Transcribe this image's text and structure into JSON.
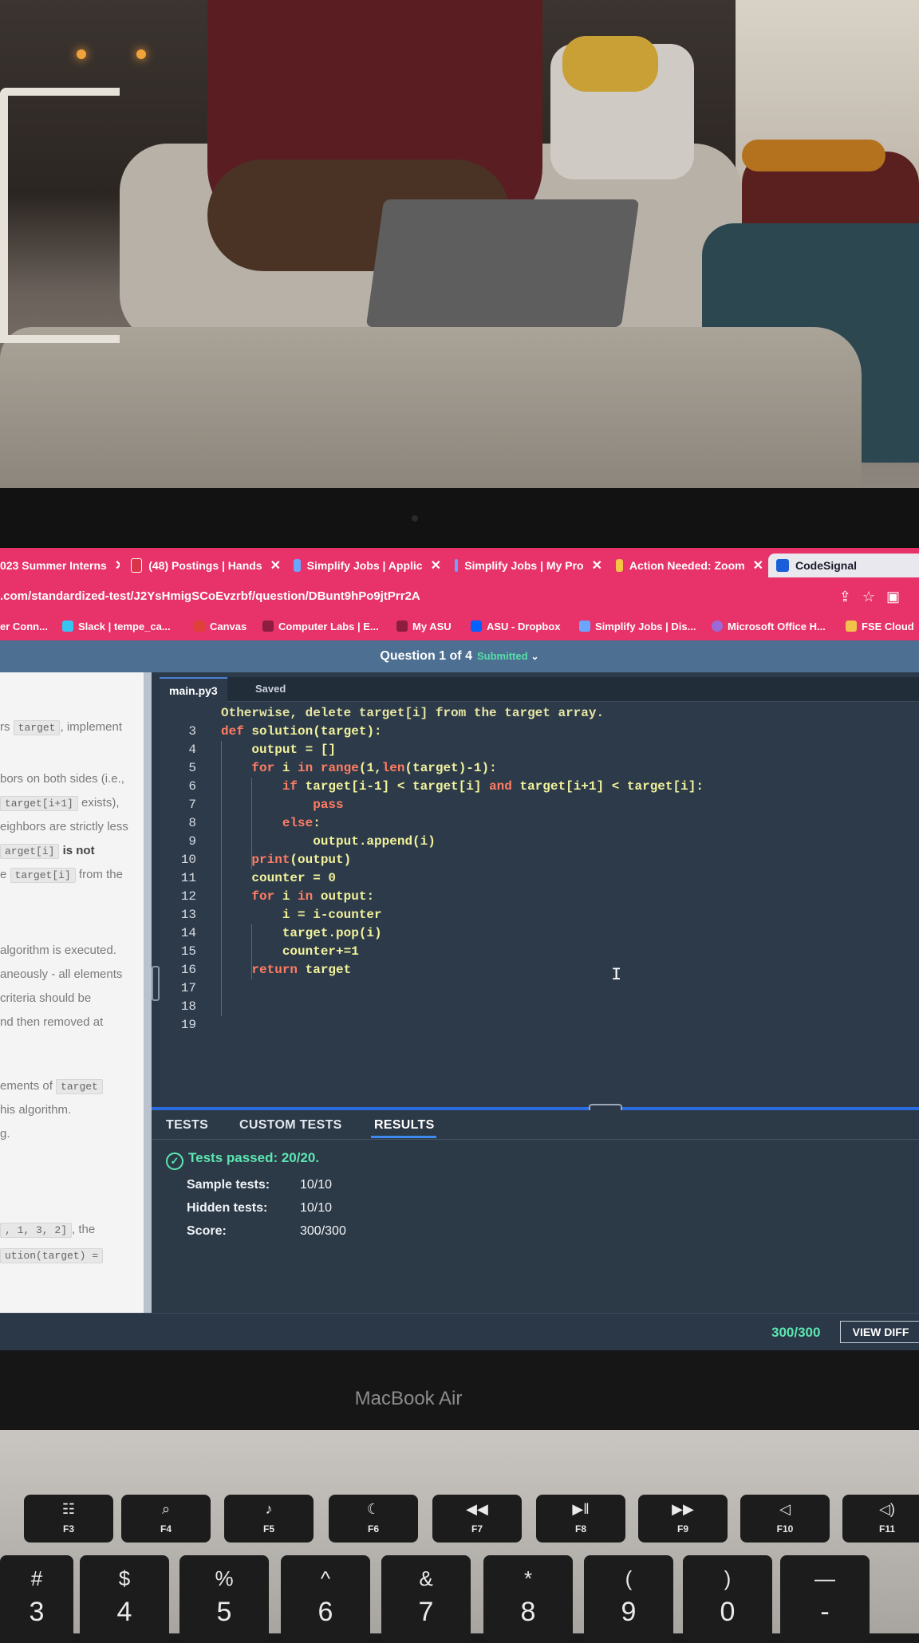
{
  "browser": {
    "tabs": [
      {
        "label": "023 Summer Interns",
        "active": false
      },
      {
        "label": "(48) Postings | Hands",
        "active": false
      },
      {
        "label": "Simplify Jobs | Applic",
        "active": false
      },
      {
        "label": "Simplify Jobs | My Pro",
        "active": false
      },
      {
        "label": "Action Needed: Zoom",
        "active": false
      },
      {
        "label": "CodeSignal",
        "active": true
      }
    ],
    "url": ".com/standardized-test/J2YsHmigSCoEvzrbf/question/DBunt9hPo9jtPrr2A",
    "bookmarks": [
      "er Conn...",
      "Slack | tempe_ca...",
      "Canvas",
      "Computer Labs | E...",
      "My ASU",
      "ASU - Dropbox",
      "Simplify Jobs | Dis...",
      "Microsoft Office H...",
      "FSE Cloud"
    ]
  },
  "header": {
    "question": "Question 1 of 4",
    "status": "Submitted",
    "chevron": "chevron-down-icon"
  },
  "left_panel": {
    "lines": [
      {
        "pre": "rs ",
        "code": "target",
        "post": ", implement"
      },
      {
        "pre": "",
        "code": "",
        "post": ""
      },
      {
        "pre": "bors on both sides (i.e.,",
        "code": "",
        "post": ""
      },
      {
        "pre": "",
        "code": "target[i+1]",
        "post": " exists),"
      },
      {
        "pre": "eighbors are strictly less",
        "code": "",
        "post": ""
      },
      {
        "pre": "",
        "code": "arget[i]",
        "post": " is not",
        "bold_post": true
      },
      {
        "pre": "e ",
        "code": "target[i]",
        "post": " from the"
      },
      {
        "pre": " algorithm is executed.",
        "code": "",
        "post": ""
      },
      {
        "pre": "aneously - all elements",
        "code": "",
        "post": ""
      },
      {
        "pre": " criteria should be",
        "code": "",
        "post": ""
      },
      {
        "pre": "nd then removed at",
        "code": "",
        "post": ""
      },
      {
        "pre": "ements of ",
        "code": "target",
        "post": ""
      },
      {
        "pre": "his algorithm.",
        "code": "",
        "post": ""
      },
      {
        "pre": "g.",
        "code": "",
        "post": ""
      },
      {
        "pre": "",
        "code": ", 1, 3, 2]",
        "post": ", the"
      },
      {
        "pre": "",
        "code": "ution(target) =",
        "post": ""
      }
    ]
  },
  "editor": {
    "file_tab": "main.py3",
    "save_status": "Saved",
    "lines": [
      {
        "n": "",
        "text": "Otherwise, delete target[i] from the target array."
      },
      {
        "n": "3",
        "text": "def solution(target):"
      },
      {
        "n": "4",
        "text": "    output = []"
      },
      {
        "n": "5",
        "text": "    for i in range(1,len(target)-1):"
      },
      {
        "n": "6",
        "text": "        if target[i-1] < target[i] and target[i+1] < target[i]:"
      },
      {
        "n": "7",
        "text": "            pass"
      },
      {
        "n": "8",
        "text": "        else:"
      },
      {
        "n": "9",
        "text": "            output.append(i)"
      },
      {
        "n": "10",
        "text": "    print(output)"
      },
      {
        "n": "11",
        "text": "    counter = 0"
      },
      {
        "n": "12",
        "text": "    for i in output:"
      },
      {
        "n": "13",
        "text": "        i = i-counter"
      },
      {
        "n": "14",
        "text": "        target.pop(i)"
      },
      {
        "n": "15",
        "text": "        counter+=1"
      },
      {
        "n": "16",
        "text": "    return target"
      },
      {
        "n": "17",
        "text": ""
      },
      {
        "n": "18",
        "text": ""
      },
      {
        "n": "19",
        "text": ""
      }
    ]
  },
  "results": {
    "tabs": [
      "TESTS",
      "CUSTOM TESTS",
      "RESULTS"
    ],
    "active_tab": "RESULTS",
    "summary": "Tests passed: 20/20.",
    "stats": [
      {
        "label": "Sample tests:",
        "value": "10/10"
      },
      {
        "label": "Hidden tests:",
        "value": "10/10"
      },
      {
        "label": "Score:",
        "value": "300/300"
      }
    ]
  },
  "footer": {
    "score": "300/300",
    "view_diff": "VIEW DIFF"
  },
  "laptop": {
    "brand": "MacBook Air",
    "fkeys": [
      {
        "icon": "☷",
        "label": "F3"
      },
      {
        "icon": "⌕",
        "label": "F4"
      },
      {
        "icon": "♪",
        "label": "F5"
      },
      {
        "icon": "☾",
        "label": "F6"
      },
      {
        "icon": "◀◀",
        "label": "F7"
      },
      {
        "icon": "▶‖",
        "label": "F8"
      },
      {
        "icon": "▶▶",
        "label": "F9"
      },
      {
        "icon": "◁",
        "label": "F10"
      },
      {
        "icon": "◁)",
        "label": "F11"
      }
    ],
    "numkeys": [
      {
        "top": "#",
        "bottom": "3"
      },
      {
        "top": "$",
        "bottom": "4"
      },
      {
        "top": "%",
        "bottom": "5"
      },
      {
        "top": "^",
        "bottom": "6"
      },
      {
        "top": "&",
        "bottom": "7"
      },
      {
        "top": "*",
        "bottom": "8"
      },
      {
        "top": "(",
        "bottom": "9"
      },
      {
        "top": ")",
        "bottom": "0"
      },
      {
        "top": "—",
        "bottom": "-"
      }
    ]
  },
  "colors": {
    "chrome_pink": "#e8326a",
    "header_blue": "#4d6f91",
    "editor_bg": "#2d3a4a",
    "code_yellow": "#f1f29a",
    "keyword_orange": "#ff7d62",
    "success_green": "#5ce6b2"
  }
}
